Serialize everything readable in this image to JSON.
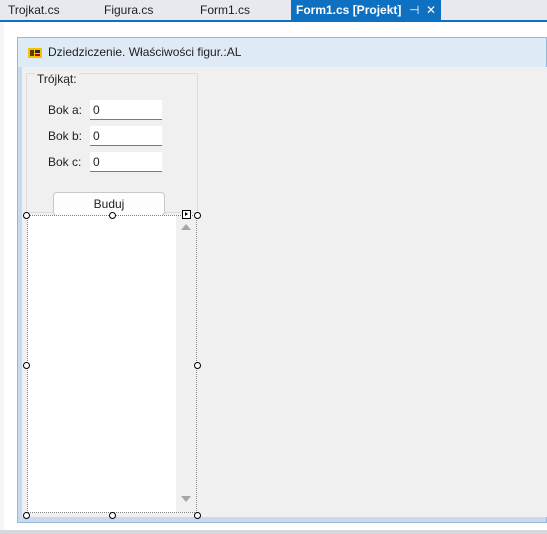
{
  "tabs": [
    {
      "label": "Trojkat.cs",
      "active": false
    },
    {
      "label": "Figura.cs",
      "active": false
    },
    {
      "label": "Form1.cs",
      "active": false
    },
    {
      "label": "Form1.cs [Projekt]",
      "active": true,
      "pin_glyph": "⊣",
      "close_glyph": "✕"
    }
  ],
  "form": {
    "title": "Dziedziczenie. Właściwości figur.:AL",
    "icon": "app-icon"
  },
  "groupbox": {
    "label": "Trójkąt:",
    "fields": [
      {
        "label": "Bok a:",
        "value": "0"
      },
      {
        "label": "Bok b:",
        "value": "0"
      },
      {
        "label": "Bok c:",
        "value": "0"
      }
    ],
    "build_button": "Buduj"
  },
  "listbox": {
    "items": [],
    "scroll_up_icon": "scroll-up-icon",
    "scroll_down_icon": "scroll-down-icon"
  },
  "colors": {
    "tab_active": "#0e70c0",
    "form_border": "#c8daf0",
    "client_bg": "#f0f0f0"
  }
}
